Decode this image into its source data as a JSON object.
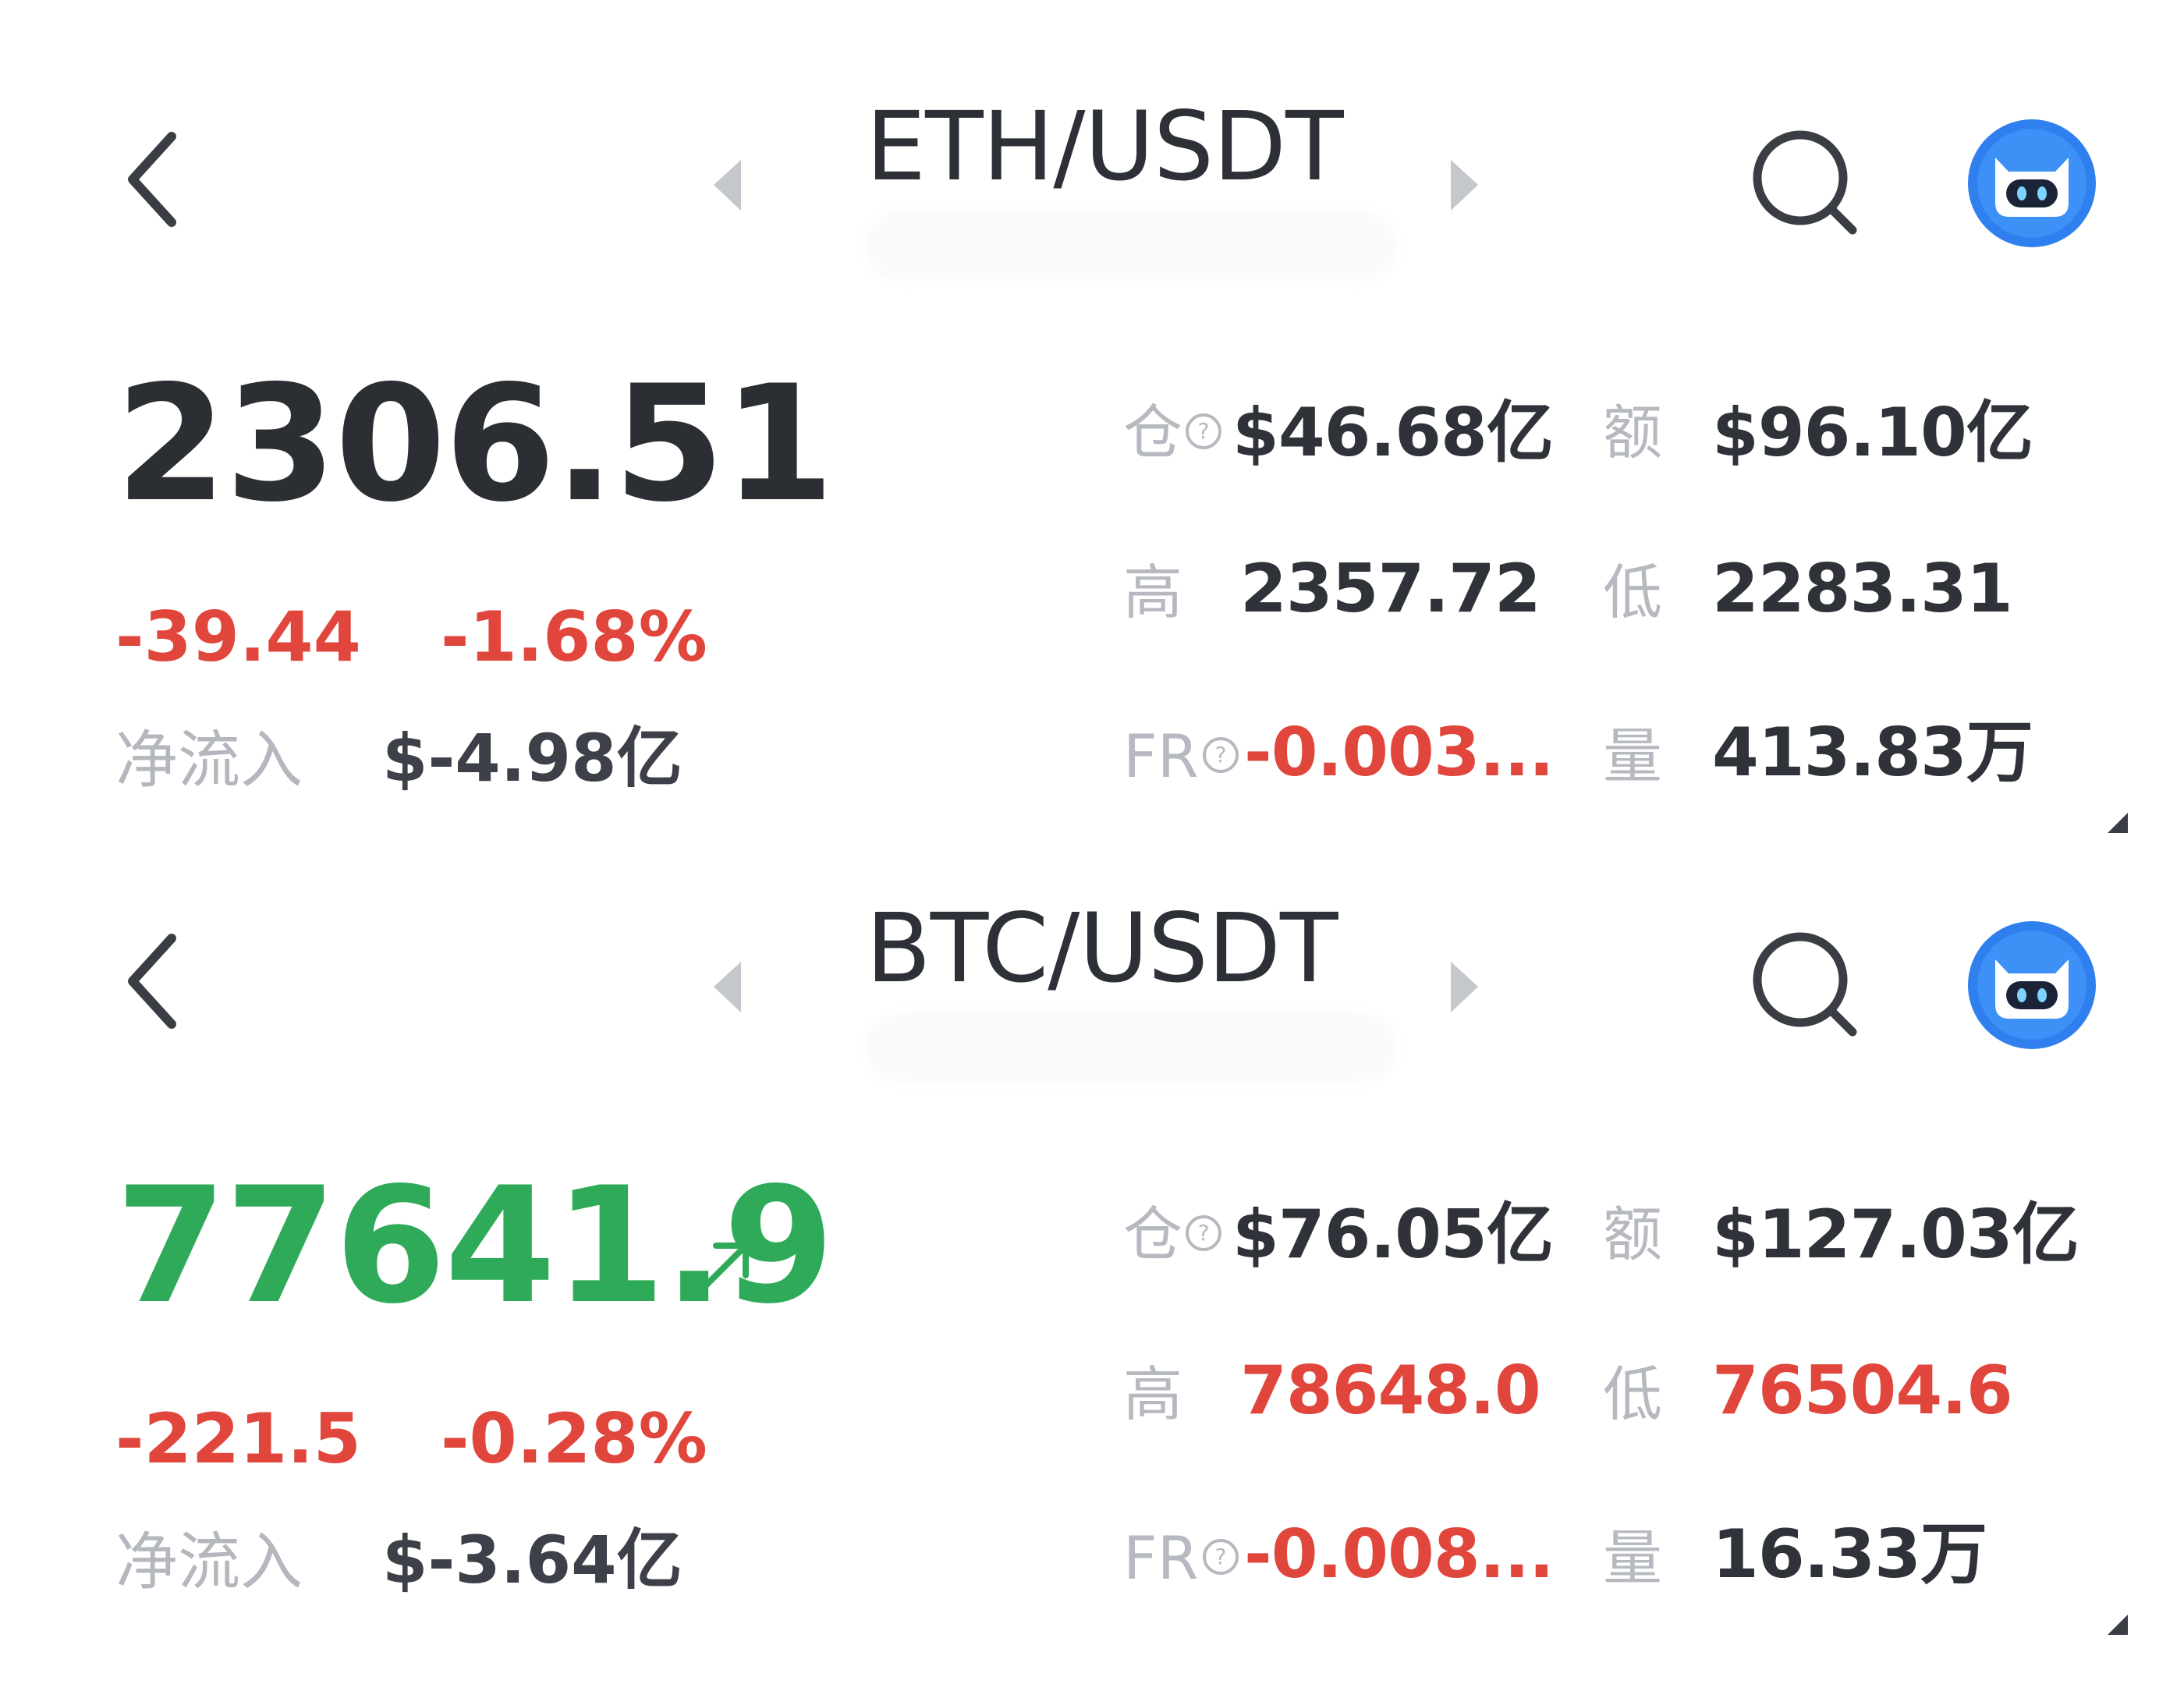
{
  "cards": [
    {
      "pair": "ETH/USDT",
      "last_price": "2306.51",
      "price_color": "#2b2e33",
      "trend_arrow": false,
      "change_abs": "-39.44",
      "change_pct": "-1.68%",
      "netflow_label": "净流入",
      "netflow_value": "$-4.98亿",
      "stats": {
        "open_interest_label": "仓",
        "open_interest_value": "$46.68亿",
        "turnover_label": "额",
        "turnover_value": "$96.10亿",
        "high_label": "高",
        "high_value": "2357.72",
        "low_label": "低",
        "low_value": "2283.31",
        "funding_rate_label": "FR",
        "funding_rate_value": "-0.003...",
        "volume_label": "量",
        "volume_value": "413.83万"
      },
      "high_low_red": false
    },
    {
      "pair": "BTC/USDT",
      "last_price": "77641.9",
      "price_color": "#2eaa58",
      "trend_arrow": true,
      "change_abs": "-221.5",
      "change_pct": "-0.28%",
      "netflow_label": "净流入",
      "netflow_value": "$-3.64亿",
      "stats": {
        "open_interest_label": "仓",
        "open_interest_value": "$76.05亿",
        "turnover_label": "额",
        "turnover_value": "$127.03亿",
        "high_label": "高",
        "high_value": "78648.0",
        "low_label": "低",
        "low_value": "76504.6",
        "funding_rate_label": "FR",
        "funding_rate_value": "-0.008...",
        "volume_label": "量",
        "volume_value": "16.33万"
      },
      "high_low_red": true
    }
  ],
  "icons": {
    "back": "chevron-left-icon",
    "prev_pair": "caret-left-icon",
    "next_pair": "caret-right-icon",
    "search": "search-icon",
    "assistant": "robot-avatar-icon",
    "help": "question-circle-icon",
    "trend": "arrow-up-right-icon",
    "resize": "resize-corner-icon"
  },
  "colors": {
    "down_red": "#e0463c",
    "up_green": "#2eaa58",
    "label_gray": "#b6bac0",
    "avatar_blue": "#2f80ee"
  }
}
